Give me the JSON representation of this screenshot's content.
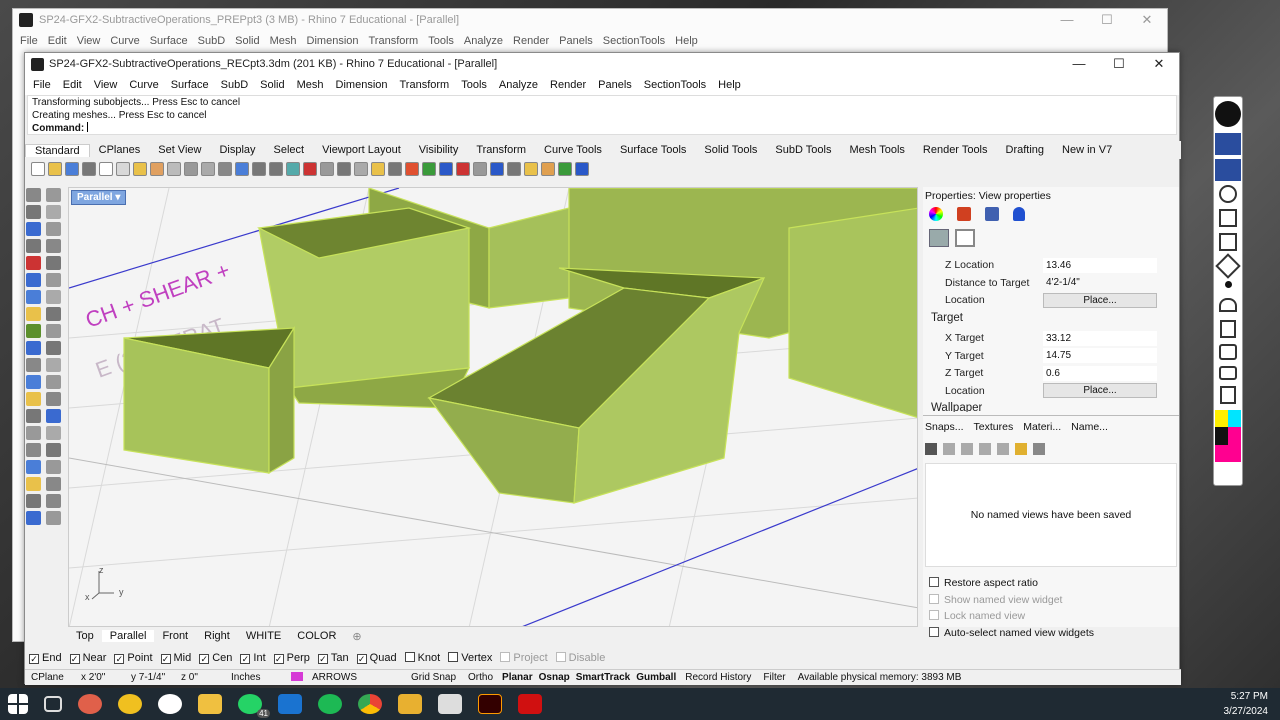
{
  "back_window": {
    "title": "SP24-GFX2-SubtractiveOperations_PREPpt3 (3 MB) - Rhino 7 Educational - [Parallel]",
    "menu": [
      "File",
      "Edit",
      "View",
      "Curve",
      "Surface",
      "SubD",
      "Solid",
      "Mesh",
      "Dimension",
      "Transform",
      "Tools",
      "Analyze",
      "Render",
      "Panels",
      "SectionTools",
      "Help"
    ]
  },
  "window": {
    "title": "SP24-GFX2-SubtractiveOperations_RECpt3.3dm (201 KB) - Rhino 7 Educational - [Parallel]",
    "controls": {
      "minimize": "—",
      "maximize": "☐",
      "close": "✕"
    }
  },
  "menu": [
    "File",
    "Edit",
    "View",
    "Curve",
    "Surface",
    "SubD",
    "Solid",
    "Mesh",
    "Dimension",
    "Transform",
    "Tools",
    "Analyze",
    "Render",
    "Panels",
    "SectionTools",
    "Help"
  ],
  "command_history": [
    "Transforming subobjects... Press Esc to cancel",
    "Creating meshes... Press Esc to cancel"
  ],
  "command_prompt": "Command:",
  "toolbar_tabs": [
    "Standard",
    "CPlanes",
    "Set View",
    "Display",
    "Select",
    "Viewport Layout",
    "Visibility",
    "Transform",
    "Curve Tools",
    "Surface Tools",
    "Solid Tools",
    "SubD Tools",
    "Mesh Tools",
    "Render Tools",
    "Drafting",
    "New in V7"
  ],
  "active_toolbar_tab": "Standard",
  "viewport": {
    "label": "Parallel",
    "tabs": [
      "Top",
      "Parallel",
      "Front",
      "Right",
      "WHITE",
      "COLOR"
    ],
    "active_tab": "Parallel",
    "add_tab": "⊕",
    "axis_labels": {
      "z": "z",
      "x": "x",
      "y": "y"
    },
    "model_color": "#a7c35a",
    "bg_text": [
      "CH + SHEAR +",
      "E (3 OPERAT"
    ]
  },
  "properties": {
    "header": "Properties: View properties",
    "rows": [
      {
        "label": "Z Location",
        "value": "13.46",
        "kind": "value"
      },
      {
        "label": "Distance to Target",
        "value": "4'2-1/4\"",
        "kind": "text"
      },
      {
        "label": "Location",
        "value": "Place...",
        "kind": "button"
      }
    ],
    "target_title": "Target",
    "target_rows": [
      {
        "label": "X Target",
        "value": "33.12",
        "kind": "value"
      },
      {
        "label": "Y Target",
        "value": "14.75",
        "kind": "value"
      },
      {
        "label": "Z Target",
        "value": "0.6",
        "kind": "value"
      },
      {
        "label": "Location",
        "value": "Place...",
        "kind": "button"
      }
    ],
    "next_section": "Wallpaper"
  },
  "named_views": {
    "tabs": [
      "Snaps...",
      "Textures",
      "Materi...",
      "Name..."
    ],
    "empty_message": "No named views have been saved",
    "options": [
      {
        "label": "Restore aspect ratio",
        "enabled": true,
        "checked": false
      },
      {
        "label": "Show named view widget",
        "enabled": false,
        "checked": false
      },
      {
        "label": "Lock named view",
        "enabled": false,
        "checked": false
      },
      {
        "label": "Auto-select named view widgets",
        "enabled": true,
        "checked": false
      }
    ]
  },
  "osnaps": [
    {
      "label": "End",
      "checked": true
    },
    {
      "label": "Near",
      "checked": true
    },
    {
      "label": "Point",
      "checked": true
    },
    {
      "label": "Mid",
      "checked": true
    },
    {
      "label": "Cen",
      "checked": true
    },
    {
      "label": "Int",
      "checked": true
    },
    {
      "label": "Perp",
      "checked": true
    },
    {
      "label": "Tan",
      "checked": true
    },
    {
      "label": "Quad",
      "checked": true
    },
    {
      "label": "Knot",
      "checked": false
    },
    {
      "label": "Vertex",
      "checked": false
    },
    {
      "label": "Project",
      "checked": false,
      "disabled": true
    },
    {
      "label": "Disable",
      "checked": false,
      "disabled": true
    }
  ],
  "status": {
    "cplane": "CPlane",
    "x": "x 2'0\"",
    "y": "y 7-1/4\"",
    "z": "z 0\"",
    "units": "Inches",
    "layer": "ARROWS",
    "layer_color": "#d63ad6",
    "toggles": [
      "Grid Snap",
      "Ortho",
      "Planar",
      "Osnap",
      "SmartTrack",
      "Gumball",
      "Record History",
      "Filter"
    ],
    "bold_toggles": [
      "Planar",
      "Osnap",
      "SmartTrack",
      "Gumball"
    ],
    "memory": "Available physical memory: 3893 MB"
  },
  "taskbar": {
    "time": "5:27 PM",
    "date": "3/27/2024",
    "badge": "41"
  }
}
